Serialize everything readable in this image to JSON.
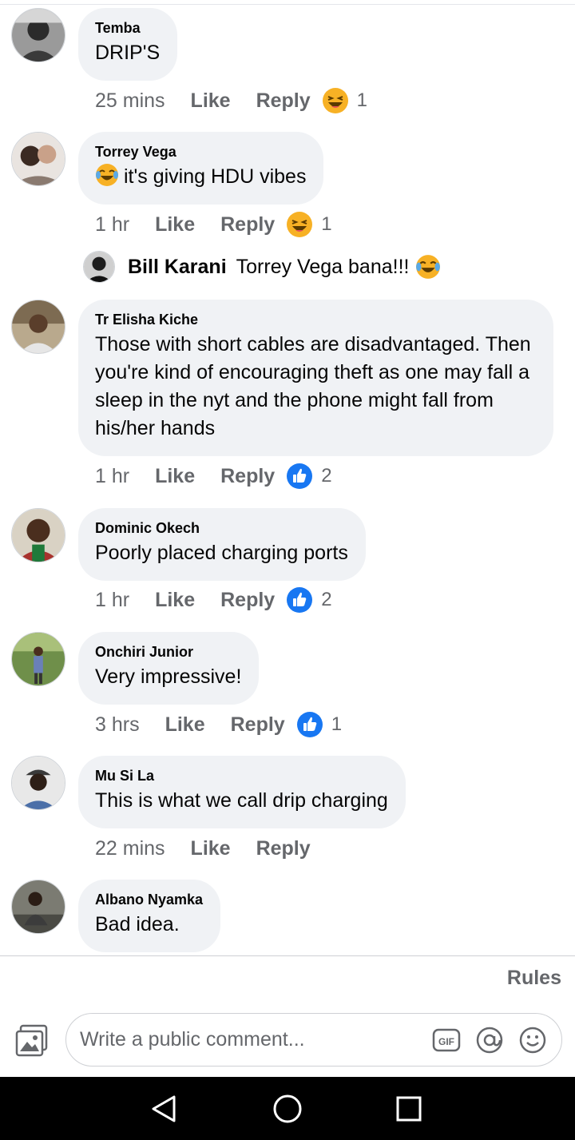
{
  "comments": [
    {
      "author": "Temba",
      "text": "DRIP'S",
      "time": "25 mins",
      "like": "Like",
      "reply": "Reply",
      "reaction": "haha",
      "reaction_count": "1"
    },
    {
      "author": "Torrey Vega",
      "text": "it's giving HDU vibes",
      "time": "1 hr",
      "like": "Like",
      "reply": "Reply",
      "reaction": "haha",
      "reaction_count": "1"
    },
    {
      "author": "Tr Elisha Kiche",
      "text": "Those with short cables are disadvantaged. Then you're kind of encouraging theft as one may fall a sleep in the nyt and the phone might fall from his/her hands",
      "time": "1 hr",
      "like": "Like",
      "reply": "Reply",
      "reaction": "like",
      "reaction_count": "2"
    },
    {
      "author": "Dominic Okech",
      "text": "Poorly placed charging ports",
      "time": "1 hr",
      "like": "Like",
      "reply": "Reply",
      "reaction": "like",
      "reaction_count": "2"
    },
    {
      "author": "Onchiri Junior",
      "text": "Very impressive!",
      "time": "3 hrs",
      "like": "Like",
      "reply": "Reply",
      "reaction": "like",
      "reaction_count": "1"
    },
    {
      "author": "Mu Si La",
      "text": "This is what we call drip charging",
      "time": "22 mins",
      "like": "Like",
      "reply": "Reply"
    },
    {
      "author": "Albano Nyamka",
      "text": "Bad idea."
    }
  ],
  "reply_preview": {
    "author": "Bill Karani",
    "text": "Torrey Vega bana!!!",
    "emoji": "tears-of-joy"
  },
  "rules_label": "Rules",
  "composer": {
    "placeholder": "Write a public comment..."
  },
  "colors": {
    "bubble": "#f0f2f5",
    "meta": "#65676b",
    "like_blue": "#1877f2",
    "emoji_yellow": "#f7b125",
    "navbar": "#000000"
  },
  "icons": [
    "photo-icon",
    "gif-icon",
    "mention-icon",
    "emoji-icon",
    "back-nav-icon",
    "home-nav-icon",
    "recents-nav-icon"
  ]
}
